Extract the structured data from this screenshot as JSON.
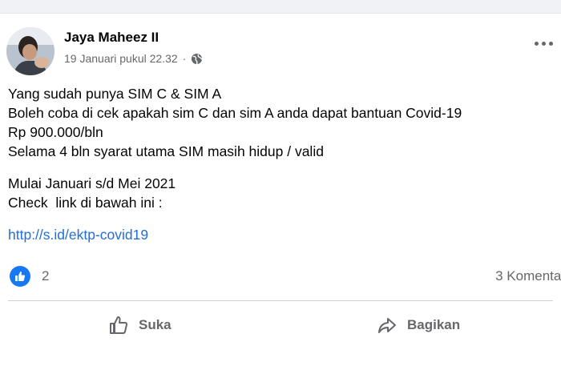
{
  "post": {
    "author": "Jaya Maheez II",
    "timestamp": "19 Januari pukul 22.32",
    "separator": "·",
    "privacy_icon": "globe-icon",
    "lines": [
      "Yang sudah punya SIM C & SIM A",
      "Boleh coba di cek apakah sim C dan sim A anda dapat bantuan Covid-19",
      "Rp 900.000/bln",
      "Selama 4 bln syarat utama SIM masih hidup / valid"
    ],
    "lines2": [
      "Mulai Januari s/d Mei 2021",
      "Check  link di bawah ini :"
    ],
    "link": "http://s.id/ektp-covid19"
  },
  "stats": {
    "reaction_count": "2",
    "comments": "3 Komentar"
  },
  "actions": {
    "like_label": "Suka",
    "share_label": "Bagikan"
  },
  "colors": {
    "link": "#216fdb",
    "like_badge": "#1877f2",
    "muted_text": "#65676b"
  }
}
